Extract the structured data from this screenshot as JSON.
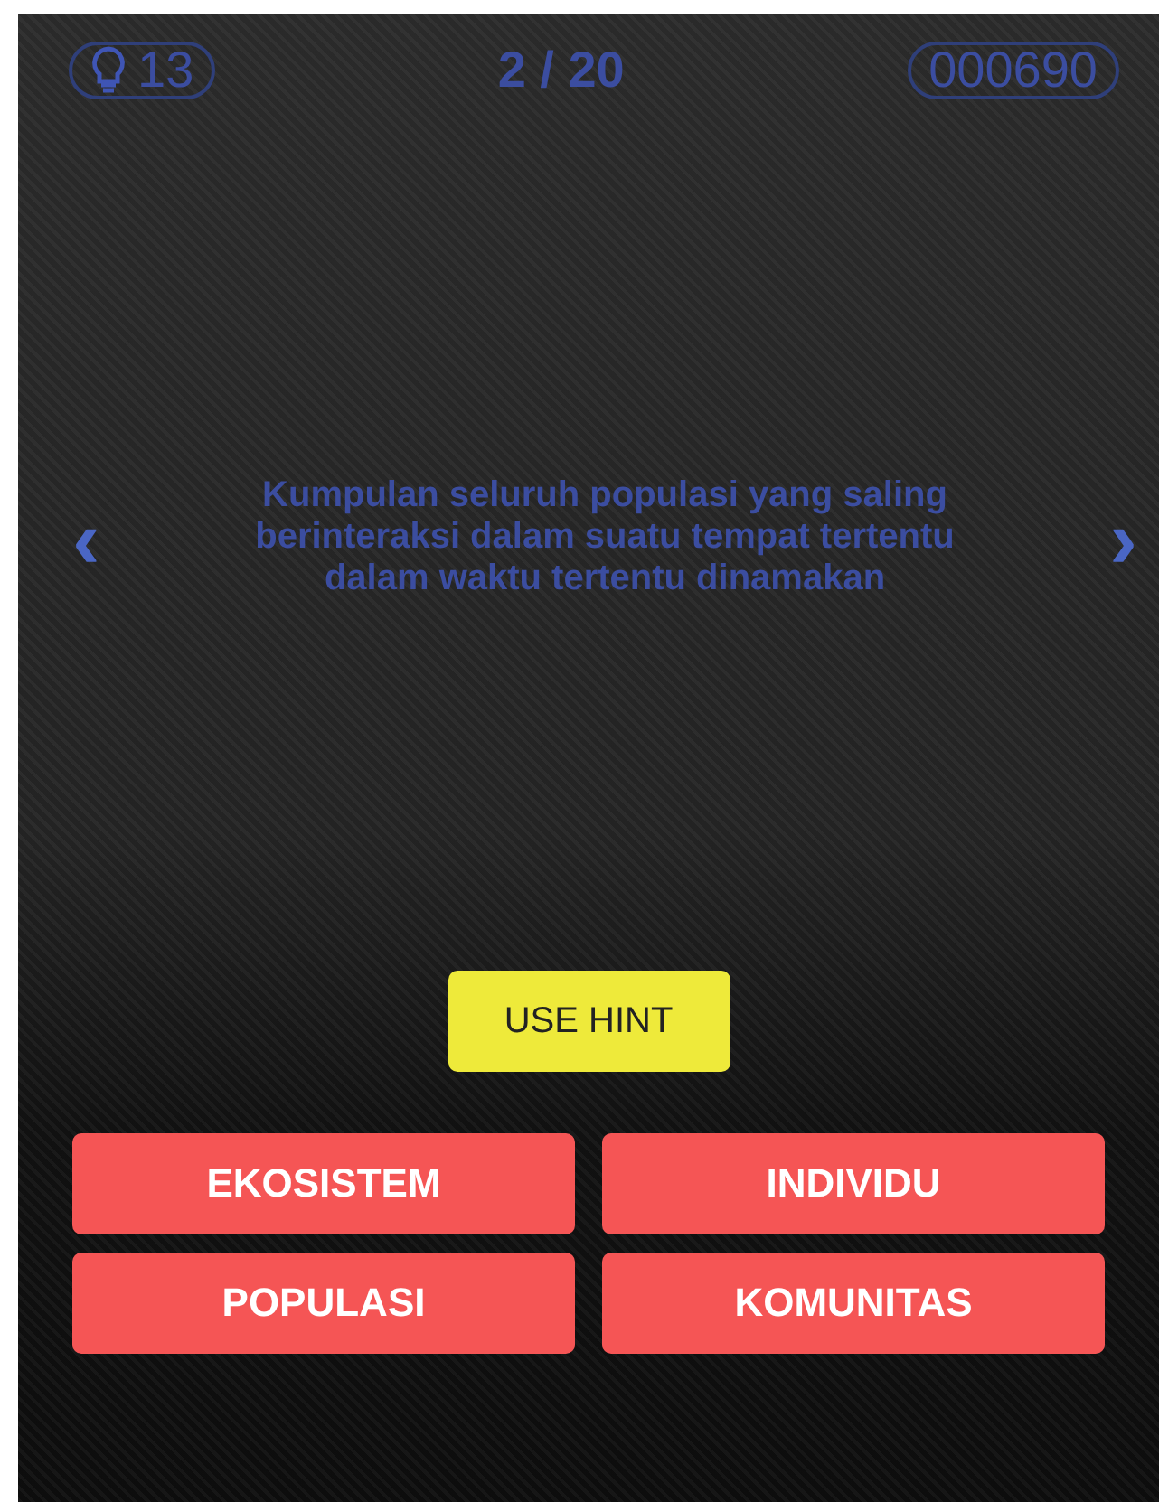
{
  "hints": {
    "count": "13"
  },
  "progress": "2 / 20",
  "score": "000690",
  "question": {
    "text": "Kumpulan seluruh populasi yang saling berinteraksi dalam suatu tempat tertentu dalam waktu tertentu dinamakan",
    "prev": "‹",
    "next": "›"
  },
  "hint_button": "USE HINT",
  "answers": [
    "EKOSISTEM",
    "INDIVIDU",
    "POPULASI",
    "KOMUNITAS"
  ]
}
